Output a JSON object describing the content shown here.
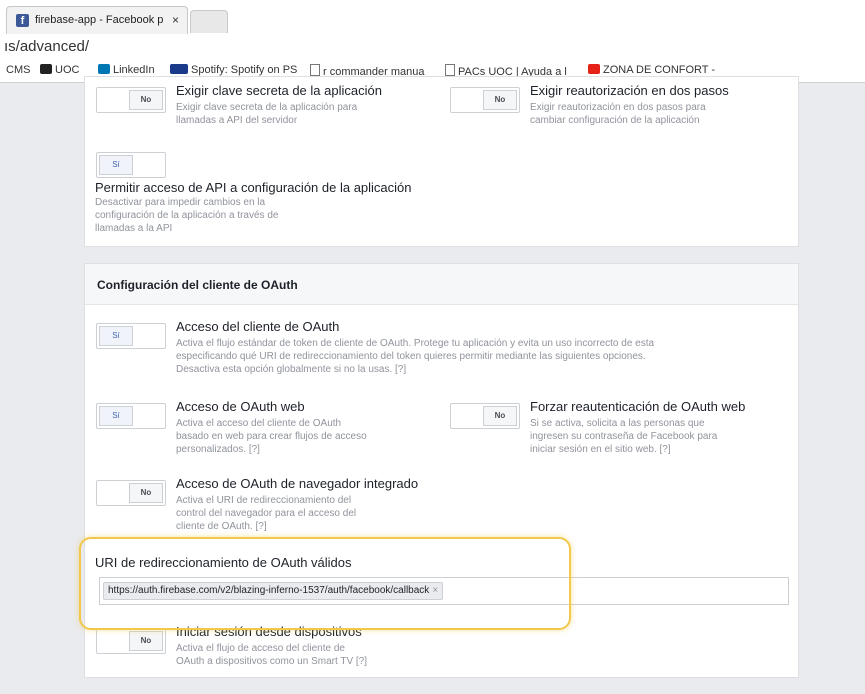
{
  "browser": {
    "tab_title": "firebase-app - Facebook p",
    "tab_close": "×",
    "url_fragment": "ıs/advanced/",
    "bookmarks": [
      {
        "label": "CMS"
      },
      {
        "label": "UOC"
      },
      {
        "label": "LinkedIn"
      },
      {
        "label": "Spotify: Spotify on PS"
      },
      {
        "label": "r commander manua"
      },
      {
        "label": "PACs UOC | Ayuda a l"
      },
      {
        "label": "ZONA DE CONFORT -"
      }
    ]
  },
  "security": {
    "secret": {
      "toggle": "No",
      "title": "Exigir clave secreta de la aplicación",
      "desc": [
        "Exigir clave secreta de la aplicación para",
        "llamadas a API del servidor"
      ]
    },
    "reauth": {
      "toggle": "No",
      "title": "Exigir reautorización en dos pasos",
      "desc": [
        "Exigir reautorización en dos pasos para",
        "cambiar configuración de la aplicación"
      ]
    },
    "api_access": {
      "toggle": "Sí",
      "title": "Permitir acceso de API a configuración de la aplicación",
      "desc": [
        "Desactivar para impedir cambios en la",
        "configuración de la aplicación a través de",
        "llamadas a la API"
      ]
    }
  },
  "oauth": {
    "section_title": "Configuración del cliente de OAuth",
    "client": {
      "toggle": "Sí",
      "title": "Acceso del cliente de OAuth",
      "desc": [
        "Activa el flujo estándar de token de cliente de OAuth. Protege tu aplicación y evita un uso incorrecto de esta",
        "especificando qué URI de redireccionamiento del token quieres permitir mediante las siguientes opciones.",
        "Desactiva esta opción globalmente si no la usas."
      ],
      "help": "[?]"
    },
    "web": {
      "toggle": "Sí",
      "title": "Acceso de OAuth web",
      "desc": [
        "Activa el acceso del cliente de OAuth",
        "basado en web para crear flujos de acceso",
        "personalizados."
      ],
      "help": "[?]"
    },
    "force_reauth": {
      "toggle": "No",
      "title": "Forzar reautenticación de OAuth web",
      "desc": [
        "Si se activa, solicita a las personas que",
        "ingresen su contraseña de Facebook para",
        "iniciar sesión en el sitio web."
      ],
      "help": "[?]"
    },
    "embedded": {
      "toggle": "No",
      "title": "Acceso de OAuth de navegador integrado",
      "desc": [
        "Activa el URI de redireccionamiento del",
        "control del navegador para el acceso del",
        "cliente de OAuth."
      ],
      "help": "[?]"
    },
    "redirect_label": "URI de redireccionamiento de OAuth válidos",
    "redirect_token": "https://auth.firebase.com/v2/blazing-inferno-1537/auth/facebook/callback",
    "redirect_token_remove": "×",
    "devices": {
      "toggle": "No",
      "title": "Iniciar sesión desde dispositivos",
      "desc": [
        "Activa el flujo de acceso del cliente de",
        "OAuth a dispositivos como un Smart TV"
      ],
      "help": "[?]"
    }
  },
  "colors": {
    "page_bg": "#e9ebee",
    "brand": "#3b5998",
    "highlight": "#f1c84b"
  }
}
